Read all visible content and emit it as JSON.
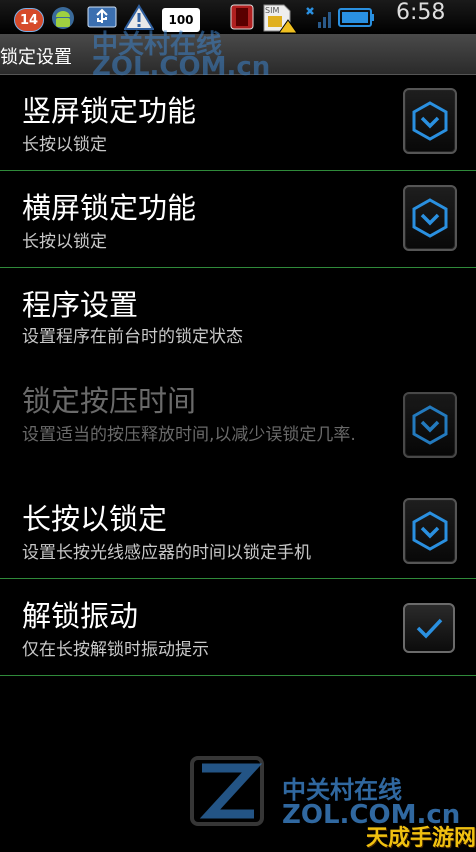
{
  "status_bar": {
    "notification_count": "14",
    "battery_percent": "100",
    "sim_label": "SIM",
    "time": "6:58",
    "icons": [
      "notification-badge-icon",
      "android-icon",
      "usb-icon",
      "warning-icon",
      "battery-percent-icon",
      "sd-card-icon",
      "sim-warning-icon",
      "signal-icon",
      "battery-icon"
    ]
  },
  "header": {
    "title": "锁定设置"
  },
  "settings": [
    {
      "title": "竖屏锁定功能",
      "subtitle": "长按以锁定",
      "control": "dropdown",
      "enabled": true
    },
    {
      "title": "横屏锁定功能",
      "subtitle": "长按以锁定",
      "control": "dropdown",
      "enabled": true
    },
    {
      "title": "程序设置",
      "subtitle": "设置程序在前台时的锁定状态",
      "control": "none",
      "enabled": true
    },
    {
      "title": "锁定按压时间",
      "subtitle": "设置适当的按压释放时间,以减少误锁定几率.",
      "control": "dropdown",
      "enabled": false
    },
    {
      "title": "长按以锁定",
      "subtitle": "设置长按光线感应器的时间以锁定手机",
      "control": "dropdown",
      "enabled": true
    },
    {
      "title": "解锁振动",
      "subtitle": "仅在长按解锁时振动提示",
      "control": "checkbox",
      "checked": true,
      "enabled": true
    }
  ],
  "watermark": {
    "top_cn": "中关村在线",
    "top_en": "ZOL.COM.cn",
    "bottom_cn": "中关村在线",
    "bottom_en": "ZOL.COM.cn",
    "corner": "天成手游网"
  },
  "colors": {
    "divider": "#2f8a3a",
    "accent_blue": "#2a90e0",
    "background": "#000000"
  }
}
